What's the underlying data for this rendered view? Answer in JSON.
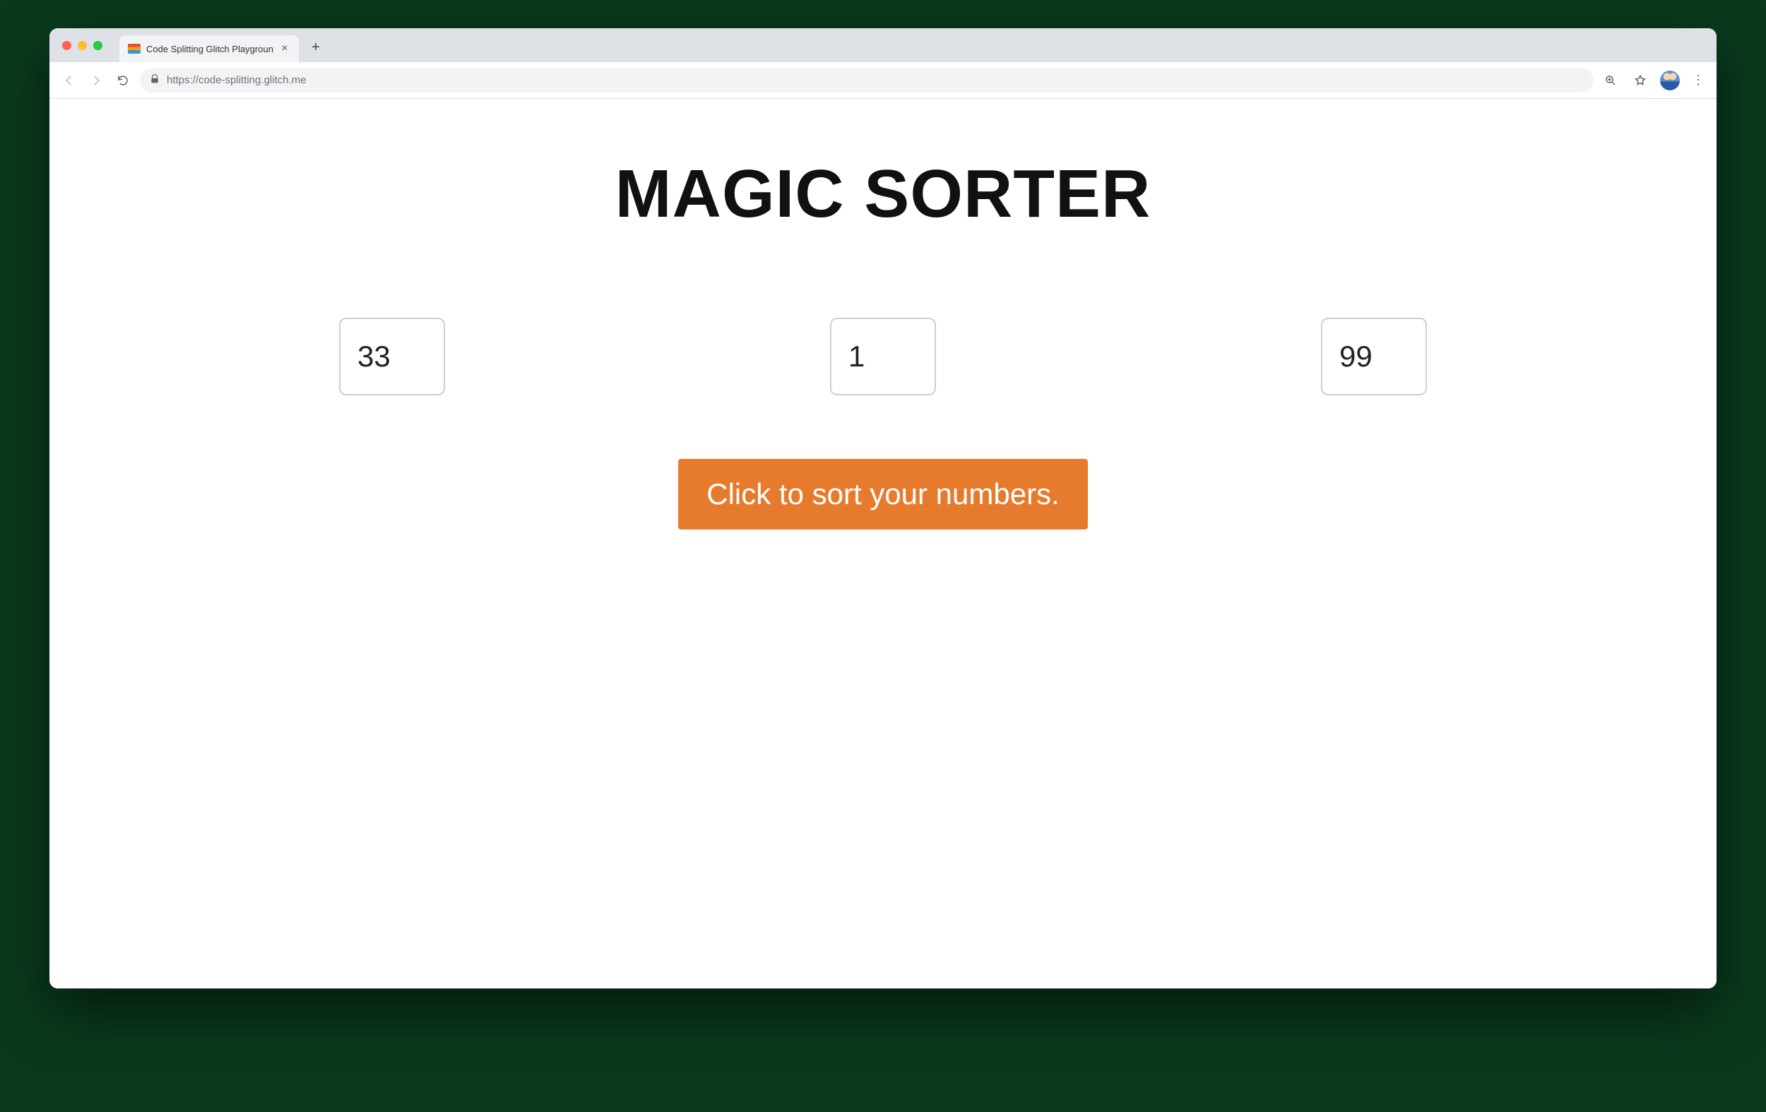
{
  "browser": {
    "tab_title": "Code Splitting Glitch Playgroun",
    "url": "https://code-splitting.glitch.me"
  },
  "page": {
    "title": "MAGIC SORTER",
    "inputs": {
      "value1": "33",
      "value2": "1",
      "value3": "99"
    },
    "sort_button_label": "Click to sort your numbers."
  },
  "colors": {
    "accent": "#e67b2e"
  }
}
